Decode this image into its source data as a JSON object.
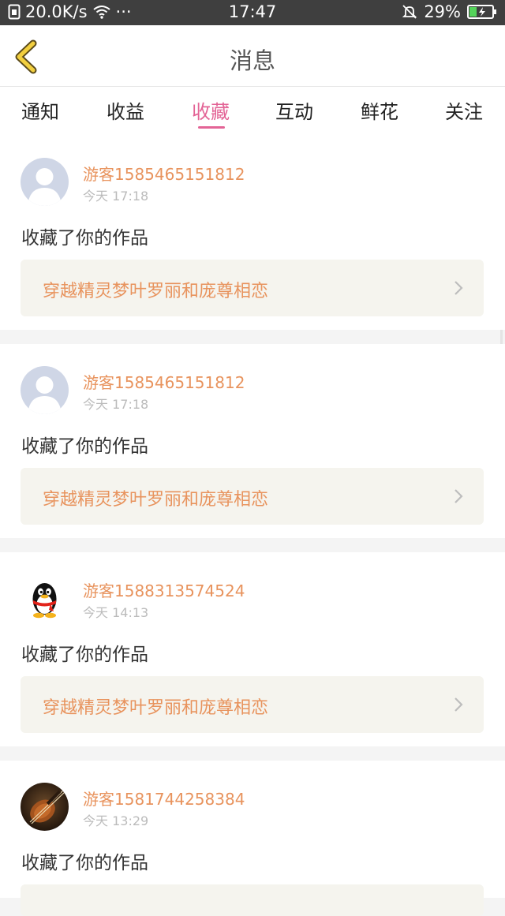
{
  "status_bar": {
    "network_speed": "20.0K/s",
    "more": "···",
    "time": "17:47",
    "battery": "29%"
  },
  "header": {
    "title": "消息"
  },
  "tabs": [
    {
      "label": "通知"
    },
    {
      "label": "收益"
    },
    {
      "label": "收藏",
      "active": true
    },
    {
      "label": "互动"
    },
    {
      "label": "鲜花"
    },
    {
      "label": "关注"
    }
  ],
  "accent_color": "#e36496",
  "name_color": "#e8935d",
  "messages": [
    {
      "username": "游客1585465151812",
      "time": "今天 17:18",
      "action": "收藏了你的作品",
      "work_title": "穿越精灵梦叶罗丽和庞尊相恋",
      "avatar": "default-avatar-icon"
    },
    {
      "username": "游客1585465151812",
      "time": "今天 17:18",
      "action": "收藏了你的作品",
      "work_title": "穿越精灵梦叶罗丽和庞尊相恋",
      "avatar": "default-avatar-icon"
    },
    {
      "username": "游客1588313574524",
      "time": "今天 14:13",
      "action": "收藏了你的作品",
      "work_title": "穿越精灵梦叶罗丽和庞尊相恋",
      "avatar": "qq-penguin-avatar"
    },
    {
      "username": "游客1581744258384",
      "time": "今天 13:29",
      "action": "收藏了你的作品",
      "work_title": "",
      "avatar": "violin-photo-avatar"
    }
  ]
}
